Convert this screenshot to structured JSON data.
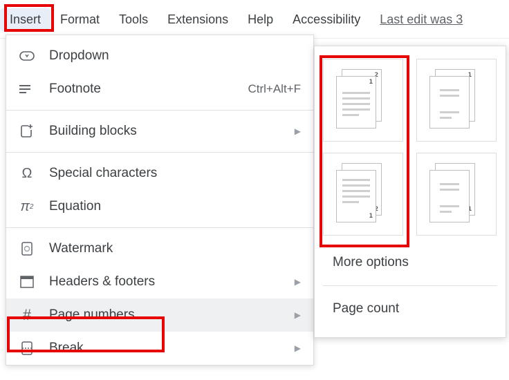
{
  "menubar": {
    "insert": "Insert",
    "format": "Format",
    "tools": "Tools",
    "extensions": "Extensions",
    "help": "Help",
    "accessibility": "Accessibility",
    "last_edit": "Last edit was 3"
  },
  "insert_menu": {
    "dropdown": {
      "label": "Dropdown"
    },
    "footnote": {
      "label": "Footnote",
      "shortcut": "Ctrl+Alt+F"
    },
    "building_blocks": {
      "label": "Building blocks"
    },
    "special_chars": {
      "label": "Special characters"
    },
    "equation": {
      "label": "Equation"
    },
    "watermark": {
      "label": "Watermark"
    },
    "headers_footers": {
      "label": "Headers & footers"
    },
    "page_numbers": {
      "label": "Page numbers"
    },
    "break": {
      "label": "Break"
    }
  },
  "page_numbers_submenu": {
    "more_options": "More options",
    "page_count": "Page count",
    "thumb_labels": {
      "one": "1",
      "two": "2"
    }
  }
}
